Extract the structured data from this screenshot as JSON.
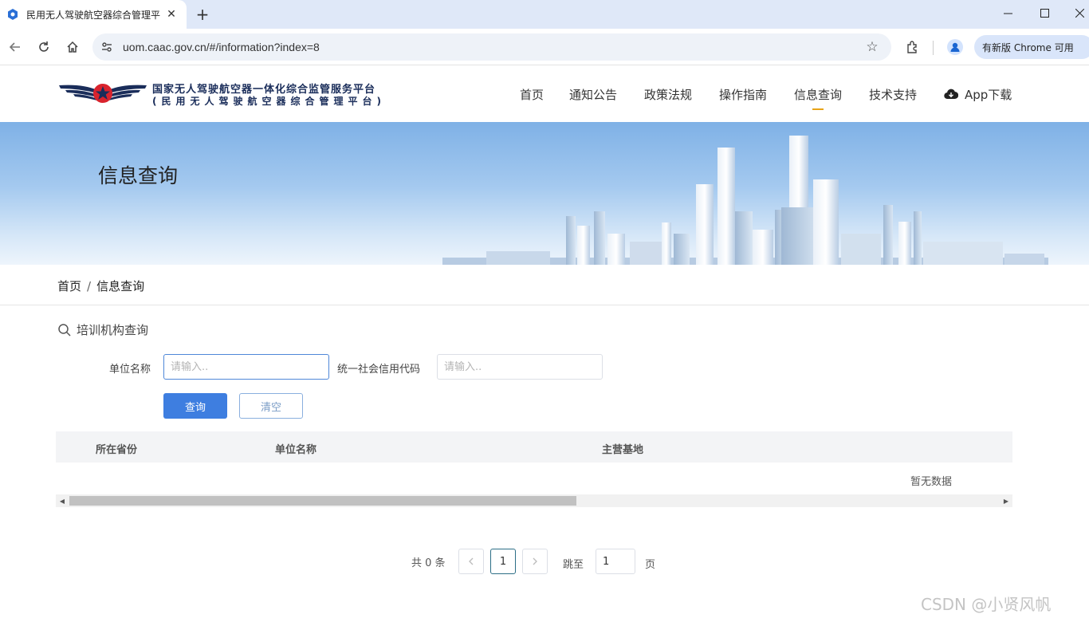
{
  "browser": {
    "tab_title": "民用无人驾驶航空器综合管理平",
    "url": "uom.caac.gov.cn/#/information?index=8",
    "update_label": "有新版 Chrome 可用"
  },
  "site": {
    "logo_line1": "国家无人驾驶航空器一体化综合监管服务平台",
    "logo_line2": "(民用无人驾驶航空器综合管理平台)",
    "nav": [
      "首页",
      "通知公告",
      "政策法规",
      "操作指南",
      "信息查询",
      "技术支持"
    ],
    "active_nav": "信息查询",
    "app_download": "App下载"
  },
  "banner": {
    "title": "信息查询"
  },
  "breadcrumb": {
    "home": "首页",
    "sep": "/",
    "current": "信息查询"
  },
  "search": {
    "panel_title": "培训机构查询",
    "unit_label": "单位名称",
    "unit_placeholder": "请输入..",
    "credit_label": "统一社会信用代码",
    "credit_placeholder": "请输入..",
    "query_button": "查询",
    "clear_button": "清空"
  },
  "table": {
    "columns": [
      "所在省份",
      "单位名称",
      "主营基地"
    ],
    "empty_text": "暂无数据"
  },
  "pagination": {
    "total_text": "共 0 条",
    "current_page": "1",
    "jump_prefix": "跳至",
    "jump_value": "1",
    "jump_suffix": "页"
  },
  "watermark": "CSDN @小贤风帆",
  "colors": {
    "primary": "#3e7ee0",
    "accent": "#e8a317",
    "logo_red": "#d9232d",
    "logo_navy": "#1a2d5a"
  }
}
